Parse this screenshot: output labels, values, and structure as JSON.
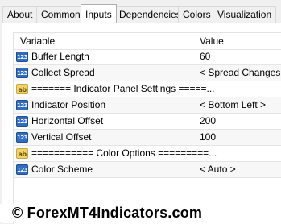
{
  "tabs": [
    "About",
    "Common",
    "Inputs",
    "Dependencies",
    "Colors",
    "Visualization"
  ],
  "active_tab": "Inputs",
  "table": {
    "headers": {
      "variable": "Variable",
      "value": "Value"
    },
    "rows": [
      {
        "icon": "123",
        "type": "number",
        "variable": "Buffer Length",
        "value": "60"
      },
      {
        "icon": "123",
        "type": "number",
        "variable": "Collect Spread",
        "value": "< Spread Changes >"
      },
      {
        "icon": "ab",
        "type": "string",
        "variable": "======= Indicator Panel Settings =====...",
        "value": ""
      },
      {
        "icon": "123",
        "type": "number",
        "variable": "Indicator Position",
        "value": "< Bottom Left >"
      },
      {
        "icon": "123",
        "type": "number",
        "variable": "Horizontal Offset",
        "value": "200"
      },
      {
        "icon": "123",
        "type": "number",
        "variable": "Vertical Offset",
        "value": "100"
      },
      {
        "icon": "ab",
        "type": "string",
        "variable": "=========== Color Options =========...",
        "value": ""
      },
      {
        "icon": "123",
        "type": "number",
        "variable": "Color Scheme",
        "value": "< Auto >"
      }
    ]
  },
  "watermark": "© ForexMT4Indicators.com"
}
